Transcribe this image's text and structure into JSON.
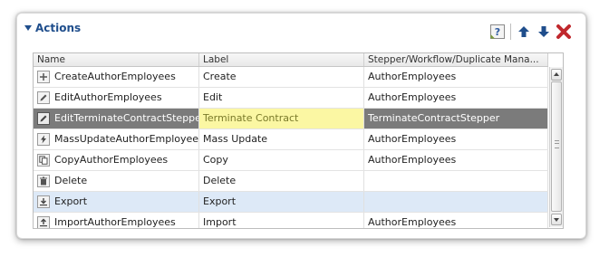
{
  "panel": {
    "title": "Actions"
  },
  "toolbar": {
    "help_icon": "help-icon",
    "move_up_icon": "arrow-up-icon",
    "move_down_icon": "arrow-down-icon",
    "delete_icon": "delete-x-icon",
    "accent_color": "#1f4e8c",
    "delete_color": "#c0282d"
  },
  "grid": {
    "columns": [
      "Name",
      "Label",
      "Stepper/Workflow/Duplicate Mana..."
    ],
    "rows": [
      {
        "icon": "plus-icon",
        "name": "CreateAuthorEmployees",
        "label": "Create",
        "stepper": "AuthorEmployees",
        "state": ""
      },
      {
        "icon": "pencil-icon",
        "name": "EditAuthorEmployees",
        "label": "Edit",
        "stepper": "AuthorEmployees",
        "state": ""
      },
      {
        "icon": "pencil-icon",
        "name": "EditTerminateContractStepper",
        "label": "Terminate Contract",
        "stepper": "TerminateContractStepper",
        "state": "selected"
      },
      {
        "icon": "lightning-icon",
        "name": "MassUpdateAuthorEmployees",
        "label": "Mass Update",
        "stepper": "AuthorEmployees",
        "state": ""
      },
      {
        "icon": "copy-icon",
        "name": "CopyAuthorEmployees",
        "label": "Copy",
        "stepper": "AuthorEmployees",
        "state": ""
      },
      {
        "icon": "trash-icon",
        "name": "Delete",
        "label": "Delete",
        "stepper": "",
        "state": ""
      },
      {
        "icon": "export-icon",
        "name": "Export",
        "label": "Export",
        "stepper": "",
        "state": "hover"
      },
      {
        "icon": "import-icon",
        "name": "ImportAuthorEmployees",
        "label": "Import",
        "stepper": "AuthorEmployees",
        "state": ""
      }
    ],
    "selected_label_bg": "#fbf7a3",
    "selected_row_bg": "#7b7b7b",
    "hover_row_bg": "#dde9f7"
  }
}
